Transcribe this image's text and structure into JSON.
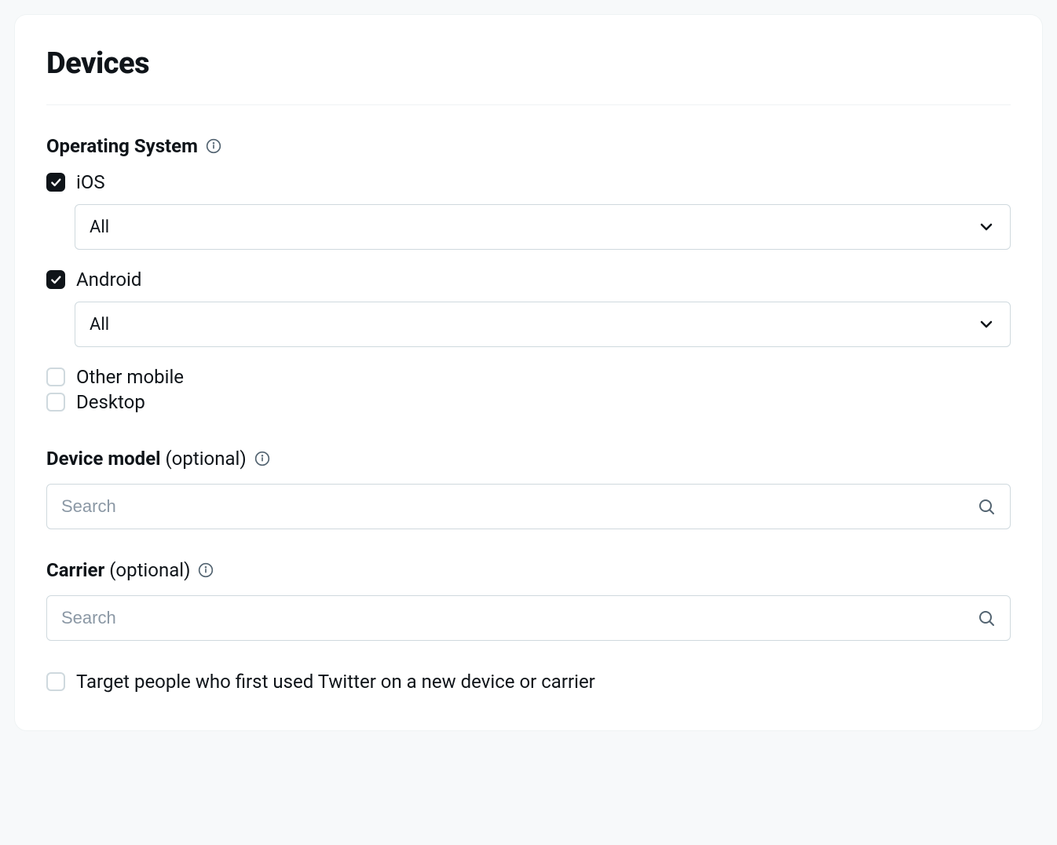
{
  "title": "Devices",
  "operating_system": {
    "label": "Operating System",
    "options": {
      "ios": {
        "label": "iOS",
        "checked": true,
        "select_value": "All"
      },
      "android": {
        "label": "Android",
        "checked": true,
        "select_value": "All"
      },
      "other_mobile": {
        "label": "Other mobile",
        "checked": false
      },
      "desktop": {
        "label": "Desktop",
        "checked": false
      }
    }
  },
  "device_model": {
    "label": "Device model",
    "optional": "(optional)",
    "search_placeholder": "Search"
  },
  "carrier": {
    "label": "Carrier",
    "optional": "(optional)",
    "search_placeholder": "Search"
  },
  "target_new": {
    "label": "Target people who first used Twitter on a new device or carrier",
    "checked": false
  }
}
